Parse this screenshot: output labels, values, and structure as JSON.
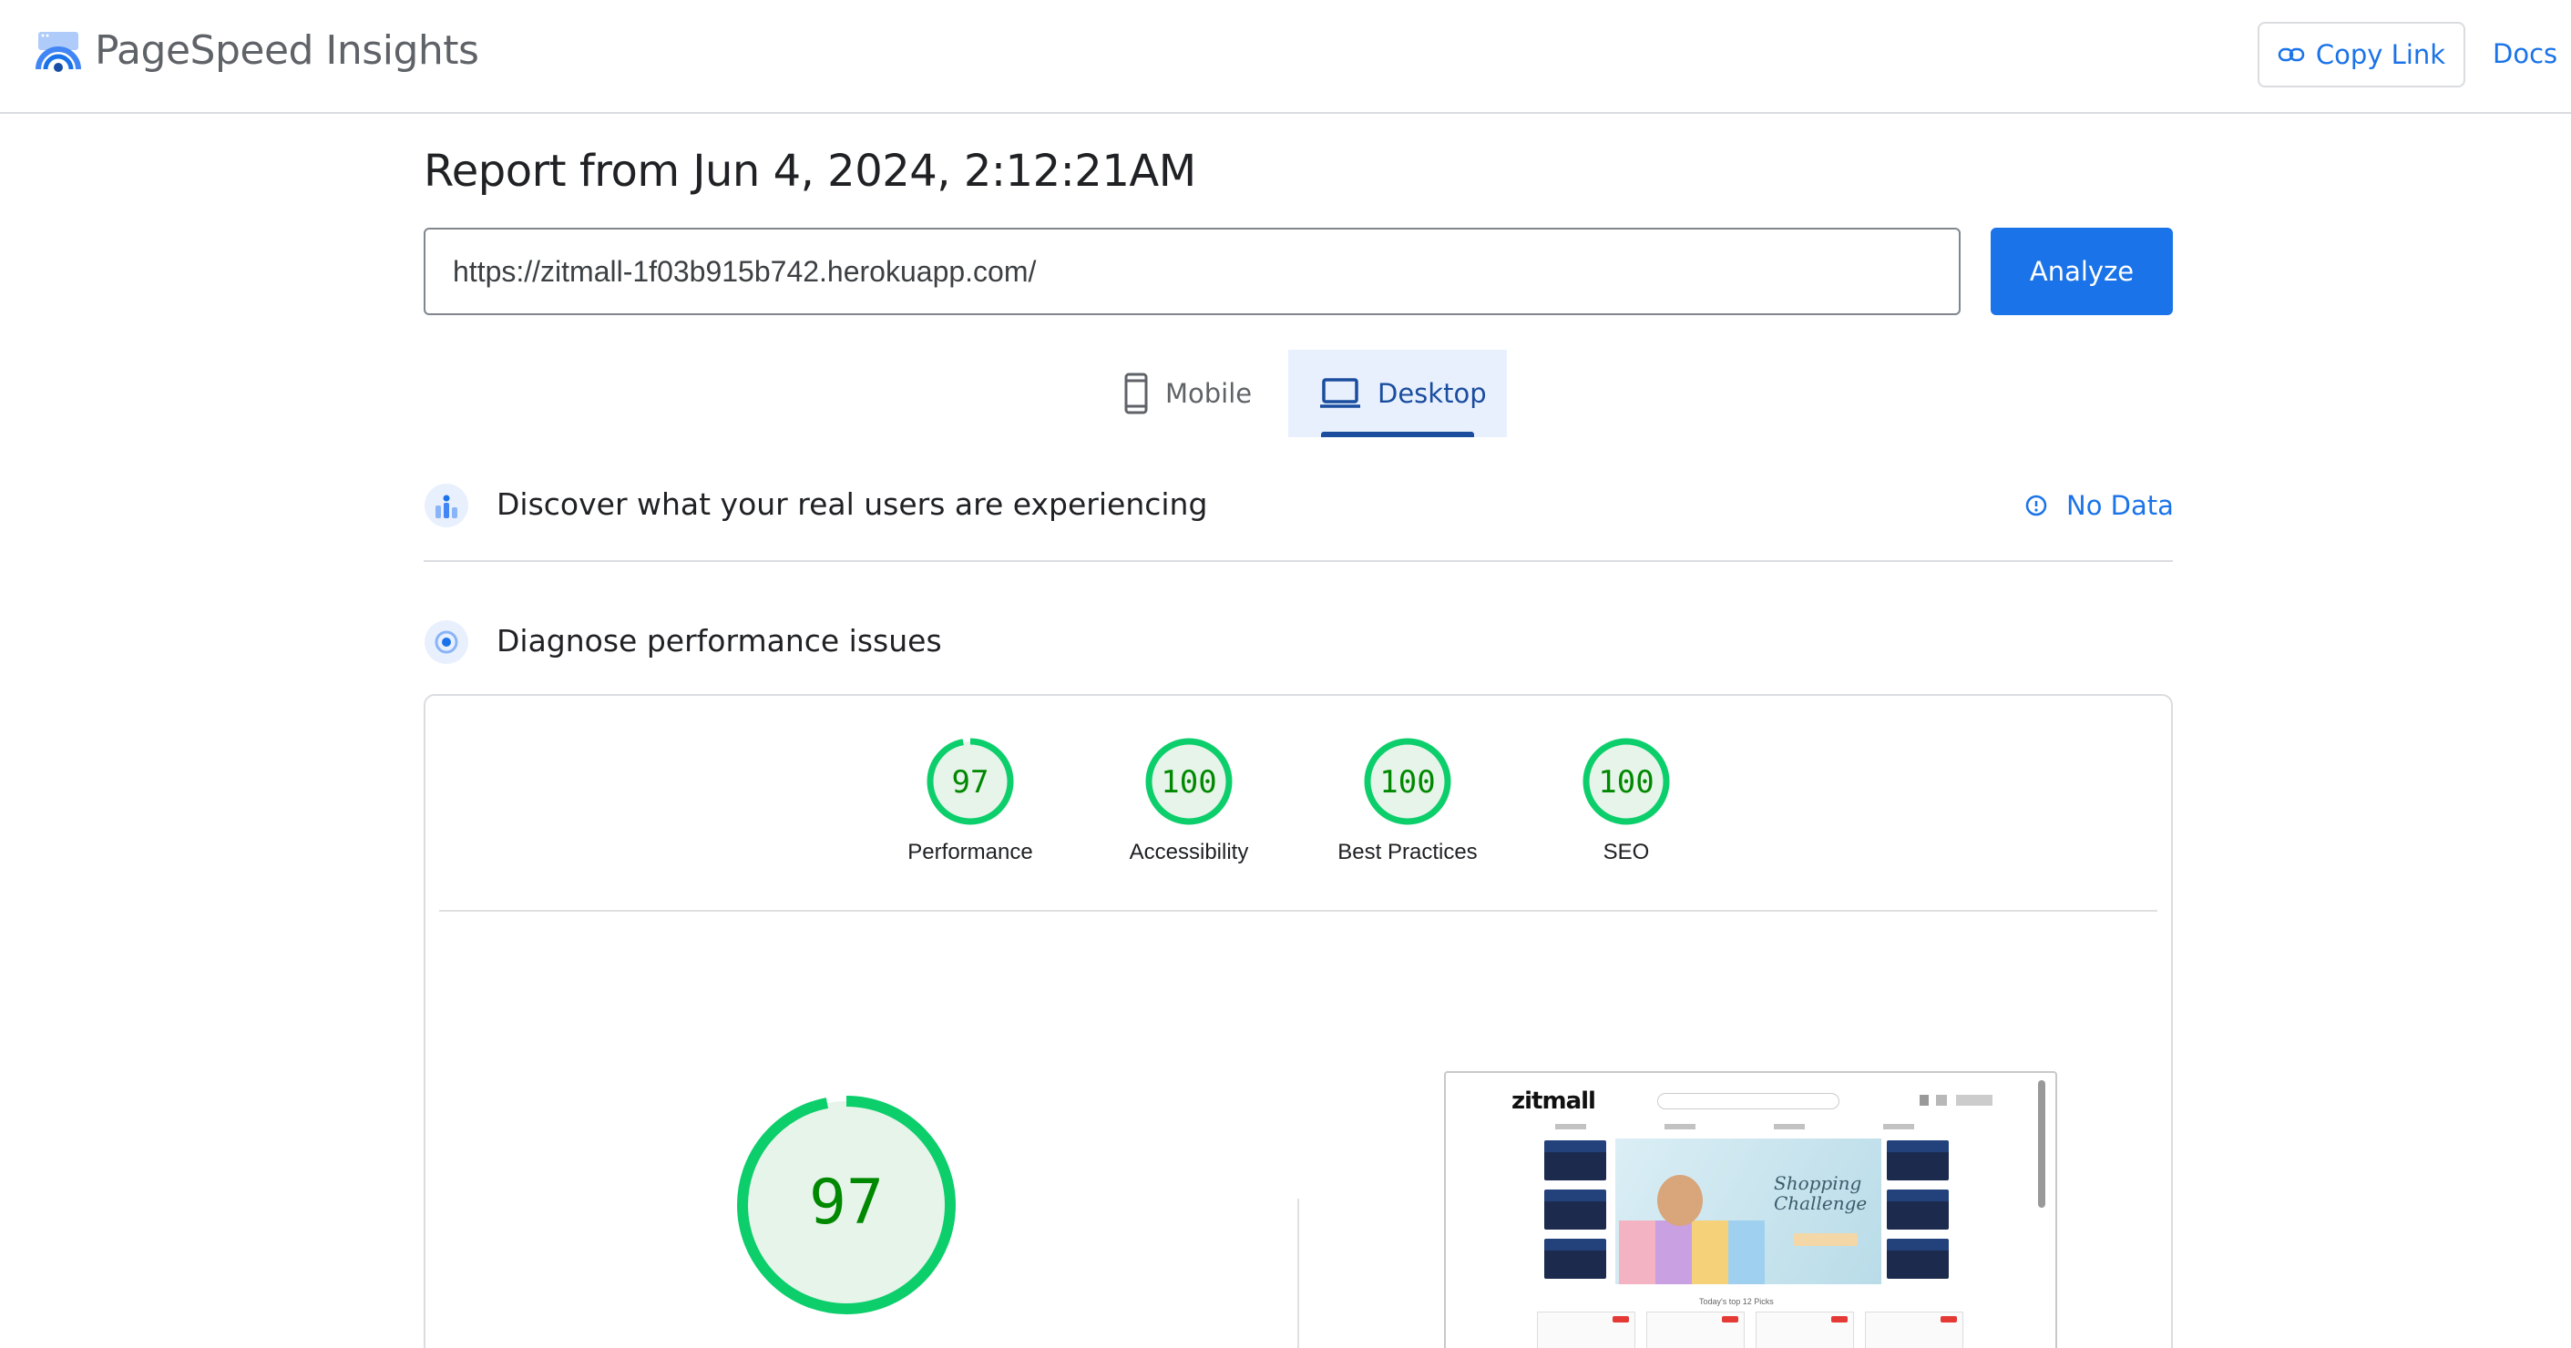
{
  "header": {
    "brand": "PageSpeed Insights",
    "copy_link": "Copy Link",
    "docs": "Docs"
  },
  "report": {
    "title": "Report from Jun 4, 2024, 2:12:21AM",
    "url": "https://zitmall-1f03b915b742.herokuapp.com/",
    "analyze": "Analyze"
  },
  "tabs": [
    {
      "label": "Mobile",
      "icon": "phone-icon",
      "selected": false
    },
    {
      "label": "Desktop",
      "icon": "laptop-icon",
      "selected": true
    }
  ],
  "sections": {
    "real_users": {
      "title": "Discover what your real users are experiencing",
      "status": "No Data"
    },
    "diagnose": {
      "title": "Diagnose performance issues"
    }
  },
  "scores": [
    {
      "label": "Performance",
      "value": "97"
    },
    {
      "label": "Accessibility",
      "value": "100"
    },
    {
      "label": "Best Practices",
      "value": "100"
    },
    {
      "label": "SEO",
      "value": "100"
    }
  ],
  "performance": {
    "score": "97"
  },
  "preview": {
    "logo": "zitmall",
    "banner_line1": "Shopping",
    "banner_line2": "Challenge",
    "caption": "Today's top 12 Picks"
  },
  "colors": {
    "accent": "#1a73e8",
    "pass": "#0cce6b",
    "pass_text": "#008800",
    "pass_bg": "#e6f4ea"
  }
}
